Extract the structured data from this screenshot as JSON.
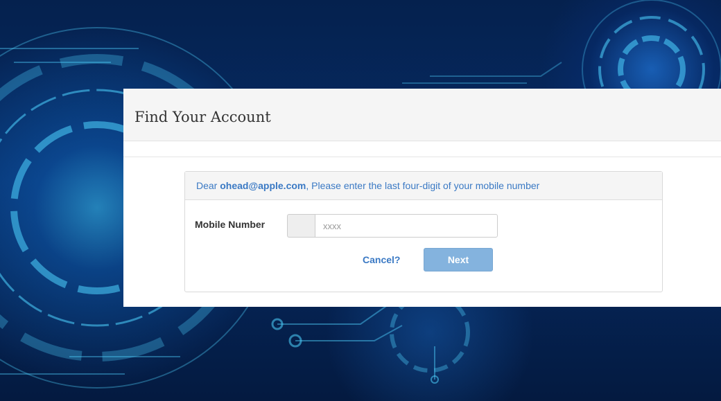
{
  "page": {
    "title": "Find Your Account"
  },
  "panel": {
    "message_prefix": "Dear ",
    "email": "ohead@apple.com",
    "message_suffix": ", Please enter the last four-digit of your mobile number"
  },
  "form": {
    "mobile_label": "Mobile Number",
    "mobile_placeholder": "xxxx",
    "mobile_value": "",
    "cancel_label": "Cancel?",
    "next_label": "Next"
  },
  "colors": {
    "link_blue": "#3a79c4",
    "next_button": "#84b3de",
    "background_dark": "#05214e"
  },
  "icons": {
    "background": "tech-circuit-background"
  }
}
